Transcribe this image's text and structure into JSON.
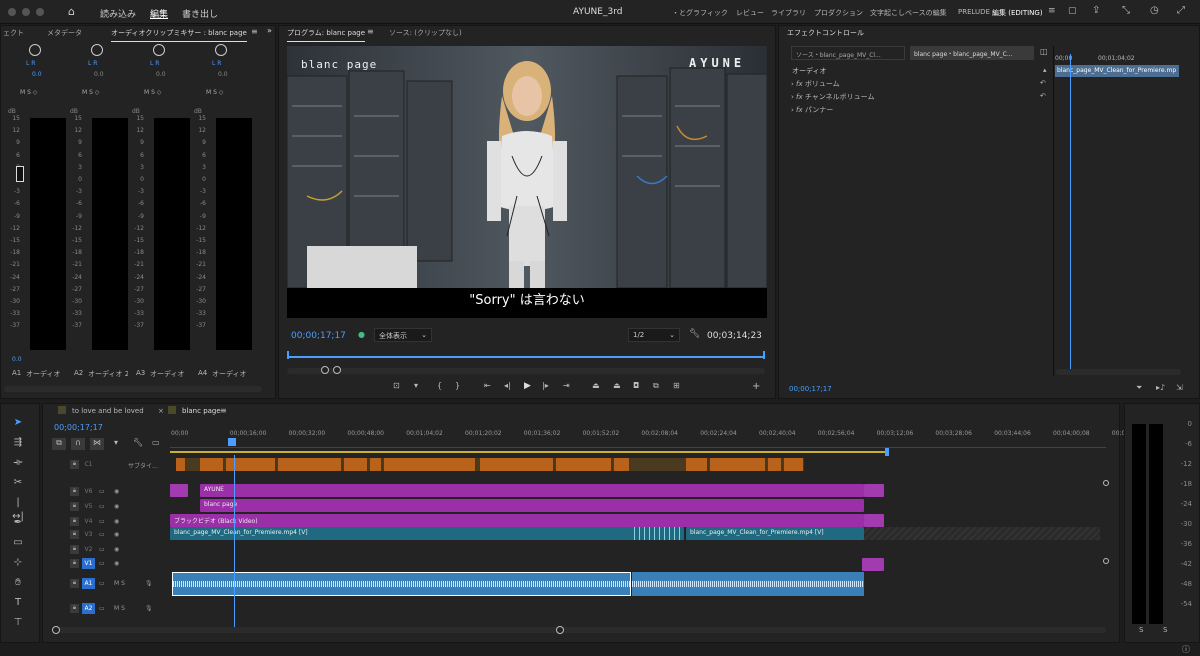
{
  "app": {
    "title": "AYUNE_3rd",
    "menus": [
      "読み込み",
      "編集",
      "書き出し"
    ],
    "workspaces": [
      "・とグラフィック",
      "レビュー",
      "ライブラリ",
      "プロダクション",
      "文字起こしベースの編集",
      "PRELUDE",
      "編集 (EDITING)"
    ]
  },
  "left_panel": {
    "tabs": [
      "ェクト",
      "メタデータ",
      "オーディオクリップミキサー : blanc page"
    ],
    "channels": [
      {
        "lr": "L R",
        "val": "0.0",
        "btns": "M S ◇",
        "id": "A1",
        "name": "オーディオ"
      },
      {
        "lr": "L R",
        "val": "0.0",
        "btns": "M S ◇",
        "id": "A2",
        "name": "オーディオ 2"
      },
      {
        "lr": "L R",
        "val": "0.0",
        "btns": "M S ◇",
        "id": "A3",
        "name": "オーディオ"
      },
      {
        "lr": "L R",
        "val": "0.0",
        "btns": "M S ◇",
        "id": "A4",
        "name": "オーディオ"
      }
    ],
    "db": "dB",
    "scale": [
      "15",
      "12",
      "9",
      "6",
      "3",
      "0",
      "-3",
      "-6",
      "-9",
      "-12",
      "-15",
      "-18",
      "-21",
      "-24",
      "-27",
      "-30",
      "-33",
      "-37"
    ],
    "fader": "0.0"
  },
  "program": {
    "tabs": [
      "プログラム: blanc page",
      "ソース: (クリップなし)"
    ],
    "overlay_left": "blanc page",
    "overlay_right": "AYUNE",
    "subtitle": "\"Sorry\" は言わない",
    "timecode": "00;00;17;17",
    "zoom": "全体表示",
    "res": "1/2",
    "duration": "00;03;14;23"
  },
  "effects": {
    "title": "エフェクトコントロール",
    "tab_source": "ソース・blanc_page_MV_Cl...",
    "tab_seq": "blanc page・blanc_page_MV_C...",
    "section": "オーディオ",
    "items": [
      "ボリューム",
      "チャンネルボリューム",
      "パンナー"
    ],
    "mini_clip": "blanc_page_MV_Clean_for_Premiere.mp",
    "mini_tc0": "00;00",
    "mini_tc1": "00;01;04;02",
    "timecode": "00;00;17;17"
  },
  "timeline": {
    "tabs": [
      "to love and be loved",
      "blanc page"
    ],
    "timecode": "00;00;17;17",
    "ruler": [
      "00;00",
      "00;00;16;00",
      "00;00;32;00",
      "00;00;48;00",
      "00;01;04;02",
      "00;01;20;02",
      "00;01;36;02",
      "00;01;52;02",
      "00;02;08;04",
      "00;02;24;04",
      "00;02;40;04",
      "00;02;56;04",
      "00;03;12;06",
      "00;03;28;06",
      "00;03;44;06",
      "00;04;00;08",
      "00;0"
    ],
    "tracks": [
      {
        "id": "C1",
        "name": "サブタイ..."
      },
      {
        "id": "V6"
      },
      {
        "id": "V5"
      },
      {
        "id": "V4"
      },
      {
        "id": "V3"
      },
      {
        "id": "V2"
      },
      {
        "id": "V1"
      },
      {
        "id": "A1",
        "btns": "M S"
      },
      {
        "id": "A2",
        "btns": "M S"
      }
    ],
    "clips": {
      "ayune": "AYUNE",
      "blanc": "blanc page",
      "black": "ブラックビデオ (Black Video)",
      "v3a": "blanc_page_MV_Clean_for_Premiere.mp4 [V]",
      "v3b": "blanc_page_MV_Clean_for_Premiere.mp4 [V]",
      "fx": "fx"
    }
  },
  "meters": {
    "scale": [
      "0",
      "-6",
      "-12",
      "-18",
      "-24",
      "-30",
      "-36",
      "-42",
      "-48",
      "-54"
    ],
    "s": "S"
  }
}
